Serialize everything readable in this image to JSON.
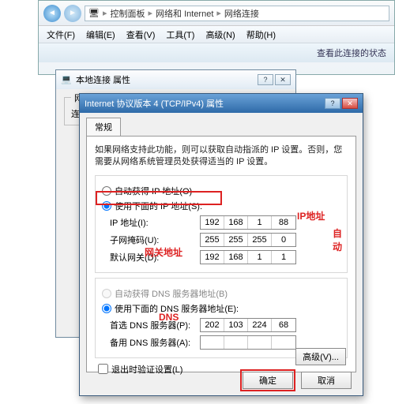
{
  "explorer": {
    "breadcrumb": {
      "p1": "控制面板",
      "p2": "网络和 Internet",
      "p3": "网络连接"
    },
    "menu": {
      "file": "文件(F)",
      "edit": "编辑(E)",
      "view": "查看(V)",
      "tools": "工具(T)",
      "adv": "高级(N)",
      "help": "帮助(H)"
    },
    "toolbar": {
      "status": "查看此连接的状态"
    }
  },
  "dialog_net": {
    "title": "本地连接 属性",
    "group_label": "网络",
    "cutoff_text": "连接时使用:"
  },
  "dialog_tcp": {
    "title": "Internet 协议版本 4 (TCP/IPv4) 属性",
    "tab": "常规",
    "description": "如果网络支持此功能，则可以获取自动指派的 IP 设置。否则，您需要从网络系统管理员处获得适当的 IP 设置。",
    "ip": {
      "radio_auto": "自动获得 IP 地址(O)",
      "radio_manual": "使用下面的 IP 地址(S):",
      "addr_label": "IP 地址(I):",
      "addr": {
        "a": "192",
        "b": "168",
        "c": "1",
        "d": "88"
      },
      "mask_label": "子网掩码(U):",
      "mask": {
        "a": "255",
        "b": "255",
        "c": "255",
        "d": "0"
      },
      "gw_label": "默认网关(D):",
      "gw": {
        "a": "192",
        "b": "168",
        "c": "1",
        "d": "1"
      }
    },
    "dns": {
      "radio_auto": "自动获得 DNS 服务器地址(B)",
      "radio_manual": "使用下面的 DNS 服务器地址(E):",
      "pref_label": "首选 DNS 服务器(P):",
      "pref": {
        "a": "202",
        "b": "103",
        "c": "224",
        "d": "68"
      },
      "alt_label": "备用 DNS 服务器(A):"
    },
    "exit_validate": "退出时验证设置(L)",
    "btn_adv": "高级(V)...",
    "btn_ok": "确定",
    "btn_cancel": "取消"
  },
  "annotations": {
    "ip": "IP地址",
    "auto": "自动",
    "gw": "网关地址",
    "dns": "DNS"
  }
}
